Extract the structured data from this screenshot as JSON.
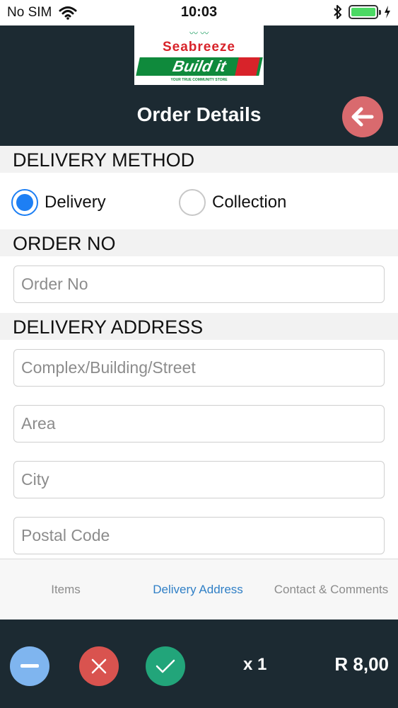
{
  "status_bar": {
    "carrier": "No SIM",
    "time": "10:03",
    "wifi_icon": "wifi-icon",
    "bluetooth_icon": "bluetooth-icon",
    "battery_level": 1.0,
    "battery_color": "#4cd964"
  },
  "header": {
    "logo": {
      "top_text": "Seabreeze",
      "brand_text": "Build it",
      "tagline": "YOUR TRUE COMMUNITY STORE"
    },
    "title": "Order Details",
    "back_icon": "arrow-left-icon",
    "background": "#1c2a32",
    "back_color": "#d96a6e"
  },
  "delivery_method": {
    "label": "DELIVERY METHOD",
    "options": [
      {
        "label": "Delivery",
        "selected": true
      },
      {
        "label": "Collection",
        "selected": false
      }
    ],
    "accent": "#1d7ff4"
  },
  "order_no": {
    "label": "ORDER NO",
    "placeholder": "Order No",
    "value": ""
  },
  "delivery_address": {
    "label": "DELIVERY ADDRESS",
    "fields": [
      {
        "placeholder": "Complex/Building/Street",
        "value": ""
      },
      {
        "placeholder": "Area",
        "value": ""
      },
      {
        "placeholder": "City",
        "value": ""
      },
      {
        "placeholder": "Postal Code",
        "value": ""
      }
    ]
  },
  "tabs": [
    {
      "label": "Items",
      "active": false
    },
    {
      "label": "Delivery Address",
      "active": true
    },
    {
      "label": "Contact & Comments",
      "active": false
    }
  ],
  "bottom_bar": {
    "buttons": [
      {
        "icon": "minus-icon",
        "color": "#7fb5ef"
      },
      {
        "icon": "close-icon",
        "color": "#d9534f"
      },
      {
        "icon": "check-icon",
        "color": "#22a57a"
      }
    ],
    "quantity": "x 1",
    "total": "R 8,00"
  }
}
